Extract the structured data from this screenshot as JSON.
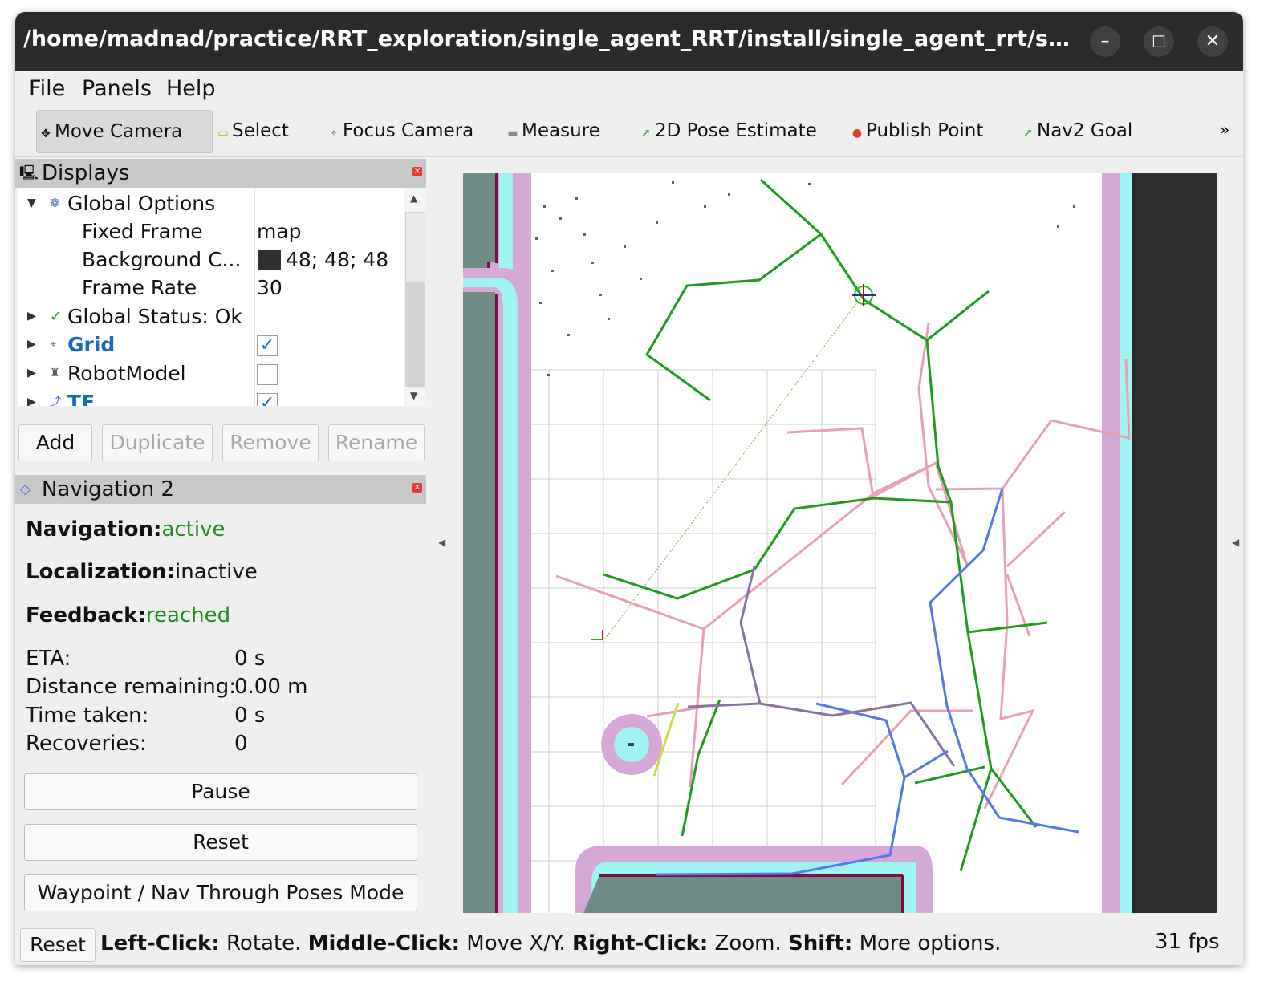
{
  "window": {
    "title": "/home/madnad/practice/RRT_exploration/single_agent_RRT/install/single_agent_rrt/share...",
    "controls": {
      "minimize": "–",
      "maximize": "☐",
      "close": "✕"
    }
  },
  "menu": [
    "File",
    "Panels",
    "Help"
  ],
  "toolbar": {
    "tools": [
      {
        "label": "Move Camera",
        "icon": "move-camera-icon",
        "active": true
      },
      {
        "label": "Select",
        "icon": "select-icon"
      },
      {
        "label": "Focus Camera",
        "icon": "focus-camera-icon"
      },
      {
        "label": "Measure",
        "icon": "measure-icon"
      },
      {
        "label": "2D Pose Estimate",
        "icon": "pose-estimate-icon"
      },
      {
        "label": "Publish Point",
        "icon": "publish-point-icon"
      },
      {
        "label": "Nav2 Goal",
        "icon": "nav2-goal-icon"
      }
    ],
    "overflow": "»"
  },
  "displays": {
    "title": "Displays",
    "rows": [
      {
        "name": "Global Options",
        "value": ""
      },
      {
        "name": "Fixed Frame",
        "value": "map"
      },
      {
        "name": "Background C...",
        "value": "48; 48; 48"
      },
      {
        "name": "Frame Rate",
        "value": "30"
      },
      {
        "name": "Global Status: Ok",
        "value": ""
      },
      {
        "name": "Grid",
        "value": "",
        "checked": true
      },
      {
        "name": "RobotModel",
        "value": "",
        "checked": false
      },
      {
        "name": "TF",
        "value": "",
        "checked": true
      }
    ],
    "background_swatch": "#303030",
    "buttons": {
      "add": "Add",
      "duplicate": "Duplicate",
      "remove": "Remove",
      "rename": "Rename"
    }
  },
  "navigation": {
    "title": "Navigation 2",
    "navigation_label": "Navigation:",
    "navigation_value": "active",
    "localization_label": "Localization:",
    "localization_value": "inactive",
    "feedback_label": "Feedback:",
    "feedback_value": "reached",
    "eta_label": "ETA:",
    "eta_value": "0 s",
    "distance_label": "Distance remaining:",
    "distance_value": "0.00 m",
    "time_label": "Time taken:",
    "time_value": "0 s",
    "recoveries_label": "Recoveries:",
    "recoveries_value": "0",
    "pause": "Pause",
    "reset": "Reset",
    "waypoint": "Waypoint / Nav Through Poses Mode"
  },
  "status": {
    "reset": "Reset",
    "hint_1_key": "Left-Click:",
    "hint_1_val": "Rotate.",
    "hint_2_key": "Middle-Click:",
    "hint_2_val": "Move X/Y.",
    "hint_3_key": "Right-Click:",
    "hint_3_val": "Zoom.",
    "hint_4_key": "Shift:",
    "hint_4_val": "More options.",
    "fps": "31 fps"
  },
  "colors": {
    "active_green": "#1f8a1f",
    "rrt_green": "#1f9a1f",
    "rrt_pink": "#e8a0b8",
    "rrt_blue": "#5577ee",
    "rrt_purple": "#8a72a0",
    "costmap_cyan": "#9ff3f3",
    "costmap_lilac": "#d5a8d8",
    "wall_gray": "#6d8c88"
  }
}
